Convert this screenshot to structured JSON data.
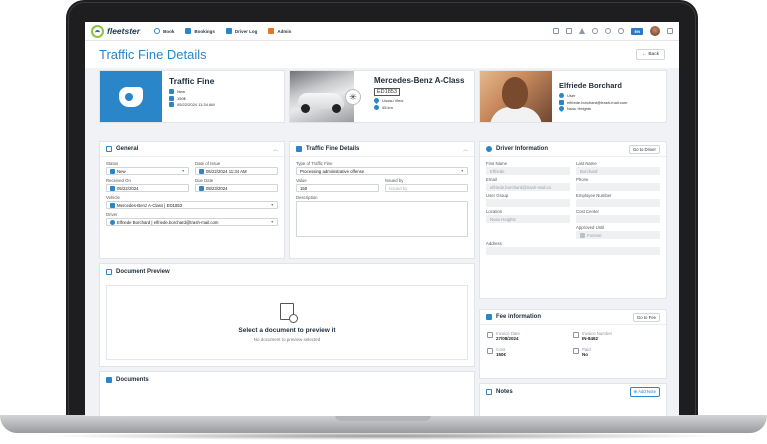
{
  "topbar": {
    "logo_text": "fleetster",
    "nav": [
      {
        "label": "Book",
        "icon": "globe-icon",
        "color": "#2a86c9"
      },
      {
        "label": "Bookings",
        "icon": "car-icon",
        "color": "#2a86c9"
      },
      {
        "label": "Driver Log",
        "icon": "logbook-icon",
        "color": "#2a86c9"
      },
      {
        "label": "Admin",
        "icon": "tools-icon",
        "color": "#e0752b"
      }
    ],
    "lang": "EN"
  },
  "page": {
    "title": "Traffic Fine Details",
    "back_label": "Back"
  },
  "fine_card": {
    "title": "Traffic Fine",
    "status": "New",
    "amount": "150€",
    "date": "05/22/2024 11:34 AM"
  },
  "vehicle_card": {
    "name": "Mercedes-Benz A-Class",
    "plate": "ED1853",
    "location": "Lisosu View",
    "mileage": "45 km"
  },
  "driver_card": {
    "name": "Elfriede Borchard",
    "role": "User",
    "email": "elfriede.borchard@trash-mail.com",
    "location": "Nusu Heights"
  },
  "general": {
    "title": "General",
    "status_label": "Status",
    "status_value": "New",
    "issue_label": "Date of Issue",
    "issue_value": "05/22/2024 11:34 AM",
    "received_label": "Received On",
    "received_value": "05/22/2024",
    "due_label": "Due Date",
    "due_value": "08/23/2024",
    "vehicle_label": "Vehicle",
    "vehicle_value": "Mercedes-Benz A-Class | ED1853",
    "driver_label": "Driver",
    "driver_value": "Elfriede Borchard | elfriede.borchard@trash-mail.com"
  },
  "fine_details": {
    "title": "Traffic Fine Details",
    "type_label": "Type of Traffic Fine",
    "type_value": "Processing administrative offense",
    "value_label": "Value",
    "value_value": "150",
    "issued_label": "Issued by",
    "issued_placeholder": "Issued by",
    "desc_label": "Description"
  },
  "driver_info": {
    "title": "Driver Information",
    "goto_label": "Go to Driver",
    "first_label": "First Name",
    "first_value": "Elfriede",
    "last_label": "Last Name",
    "last_value": "Borchard",
    "email_label": "Email",
    "email_value": "elfriede.borchard@trash-mail.co",
    "phone_label": "Phone",
    "phone_value": "",
    "group_label": "User Group",
    "group_value": "",
    "emp_label": "Employee Number",
    "emp_value": "",
    "loc_label": "Location",
    "loc_value": "Nusu Heights",
    "cost_label": "Cost Center",
    "cost_value": "",
    "approved_label": "Approved Until",
    "approved_value": "Forever",
    "address_label": "Address",
    "address_value": ""
  },
  "doc_preview": {
    "title": "Document Preview",
    "empty_title": "Select a document to preview it",
    "empty_sub": "No document to preview selected"
  },
  "documents": {
    "title": "Documents"
  },
  "fee": {
    "title": "Fee information",
    "goto_label": "Go to Fee",
    "inv_date_label": "Invoice Date",
    "inv_date_value": "27/08/2024",
    "inv_no_label": "Invoice Number",
    "inv_no_value": "IN-8462",
    "cost_label": "Cost",
    "cost_value": "150€",
    "paid_label": "Paid",
    "paid_value": "No"
  },
  "notes": {
    "title": "Notes",
    "add_label": "Add Note"
  }
}
